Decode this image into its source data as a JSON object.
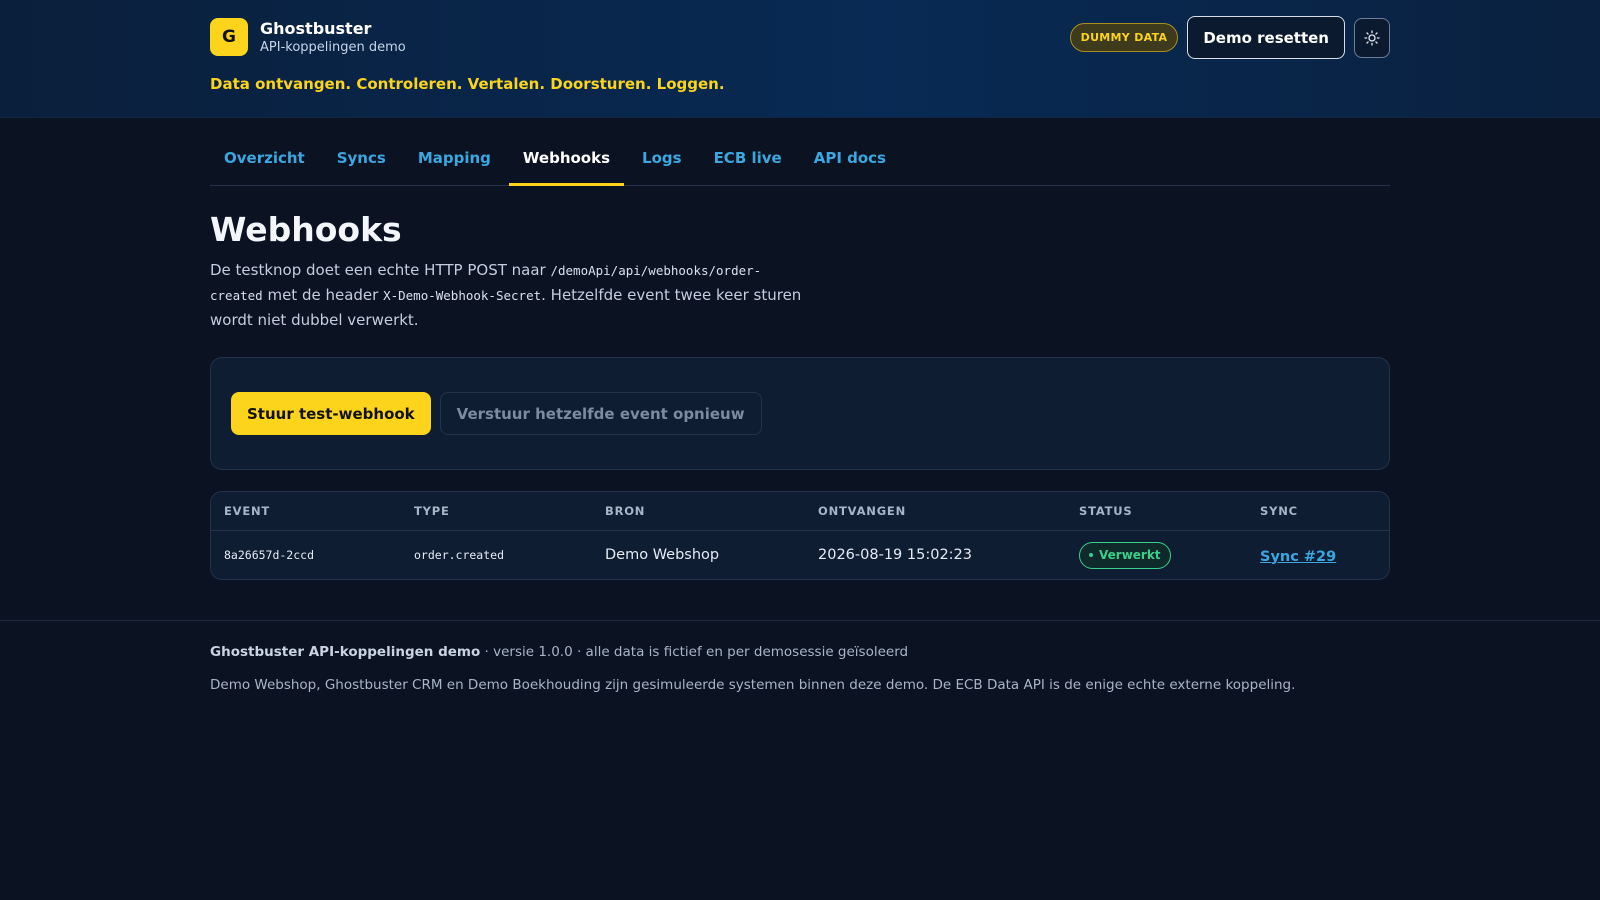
{
  "brand": {
    "logo_letter": "G",
    "name": "Ghostbuster",
    "subtitle": "API-koppelingen demo",
    "tagline": "Data ontvangen. Controleren. Vertalen. Doorsturen. Loggen."
  },
  "header": {
    "dummy_badge": "DUMMY DATA",
    "reset_label": "Demo resetten",
    "theme_icon": "sun-icon"
  },
  "tabs": [
    {
      "label": "Overzicht",
      "active": false
    },
    {
      "label": "Syncs",
      "active": false
    },
    {
      "label": "Mapping",
      "active": false
    },
    {
      "label": "Webhooks",
      "active": true
    },
    {
      "label": "Logs",
      "active": false
    },
    {
      "label": "ECB live",
      "active": false
    },
    {
      "label": "API docs",
      "active": false
    }
  ],
  "page": {
    "title": "Webhooks",
    "desc_part1": "De testknop doet een echte HTTP POST naar ",
    "desc_code1": "/demoApi/api/webhooks/order-created",
    "desc_part2": " met de header ",
    "desc_code2": "X-Demo-Webhook-Secret",
    "desc_part3": ". Hetzelfde event twee keer sturen wordt niet dubbel verwerkt."
  },
  "actions": {
    "primary_label": "Stuur test-webhook",
    "secondary_label": "Verstuur hetzelfde event opnieuw"
  },
  "table": {
    "headers": [
      "EVENT",
      "TYPE",
      "BRON",
      "ONTVANGEN",
      "STATUS",
      "SYNC"
    ],
    "rows": [
      {
        "event": "8a26657d-2ccd",
        "type": "order.created",
        "bron": "Demo Webshop",
        "ontvangen": "2026-08-19 15:02:23",
        "status": "Verwerkt",
        "sync": "Sync #29"
      }
    ]
  },
  "colors": {
    "accent": "#fcd41c",
    "link": "#3ba7e0",
    "status_ok": "#3bd08a",
    "background": "#0b1322"
  },
  "footer": {
    "app_name": "Ghostbuster API-koppelingen demo",
    "meta": " · versie 1.0.0 · alle data is fictief en per demosessie geïsoleerd",
    "note": "Demo Webshop, Ghostbuster CRM en Demo Boekhouding zijn gesimuleerde systemen binnen deze demo. De ECB Data API is de enige echte externe koppeling."
  }
}
